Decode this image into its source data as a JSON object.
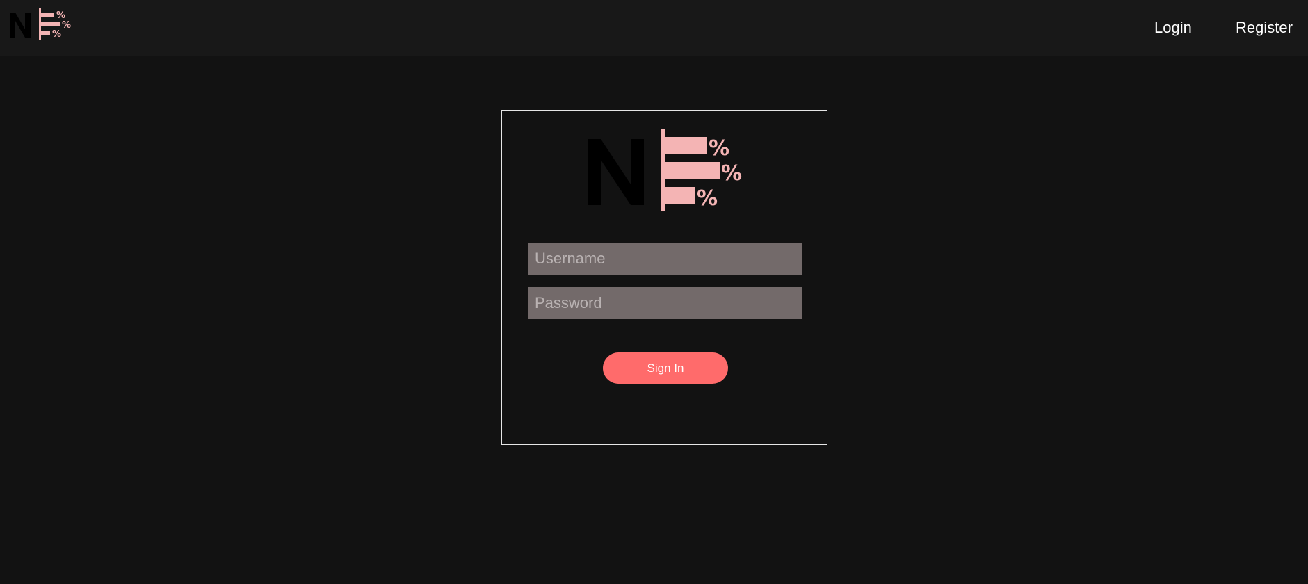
{
  "nav": {
    "logo_icon": "ne-percent-logo",
    "links": [
      {
        "label": "Login"
      },
      {
        "label": "Register"
      }
    ]
  },
  "login_form": {
    "logo_icon": "ne-percent-logo",
    "username": {
      "placeholder": "Username",
      "value": ""
    },
    "password": {
      "placeholder": "Password",
      "value": ""
    },
    "submit_label": "Sign In"
  },
  "colors": {
    "background": "#121212",
    "navbar": "#181818",
    "accent": "#ff6b6b",
    "logo_pink": "#f4b4b4",
    "input_bg": "#736a6a"
  }
}
